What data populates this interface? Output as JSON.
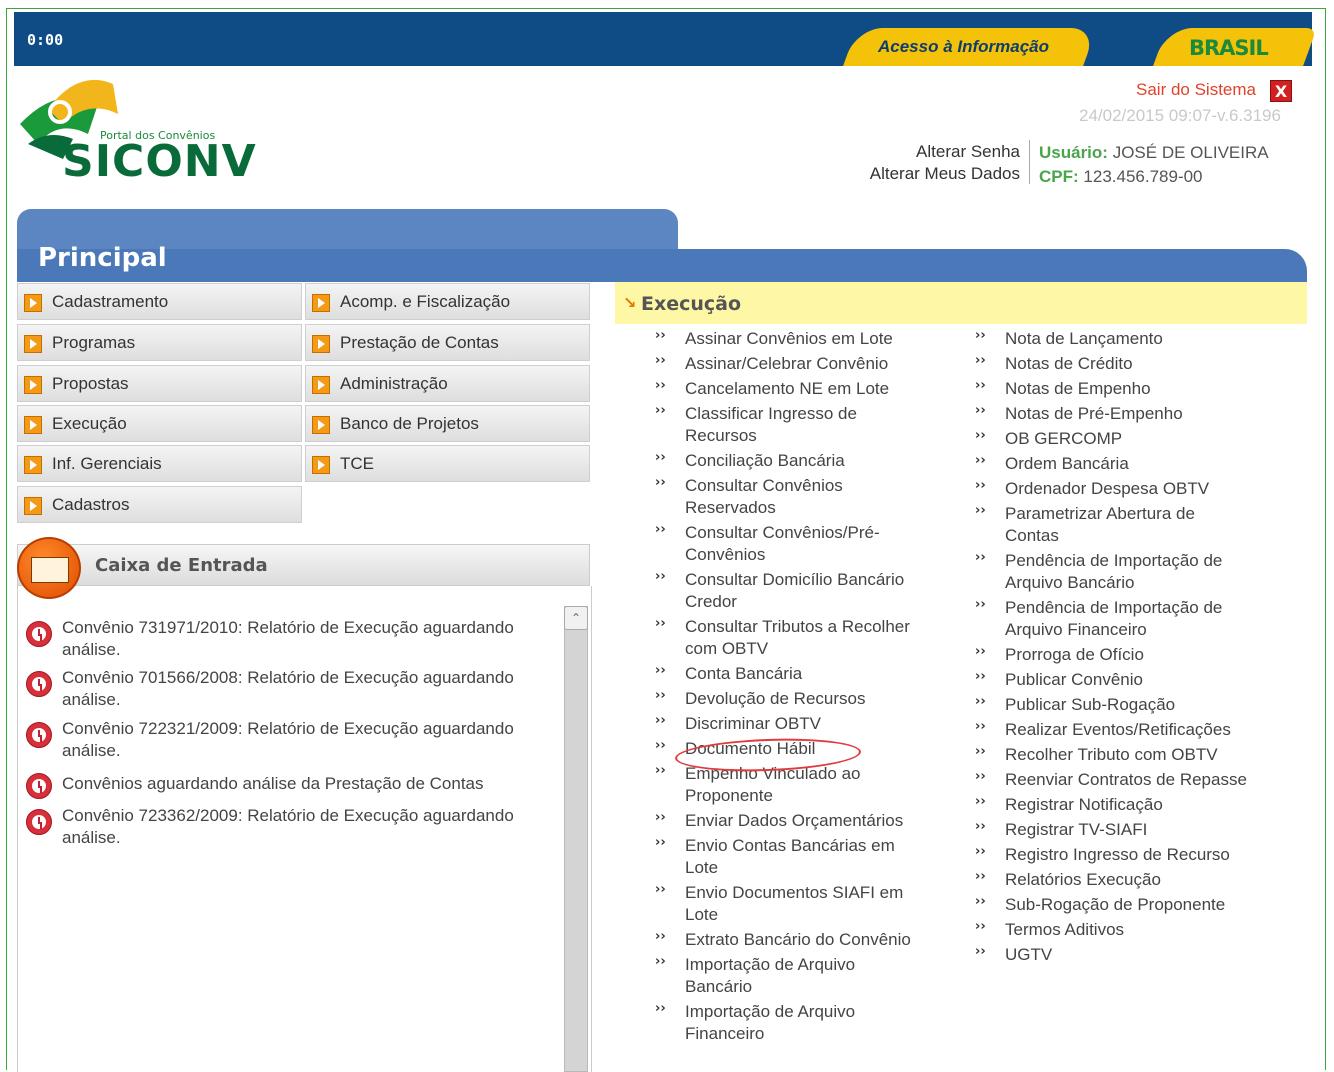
{
  "header": {
    "clock": "0:00",
    "acesso_label": "Acesso à Informação",
    "brasil_label": "BRASIL",
    "logo_sub": "Portal dos Convênios",
    "logo_main": "SICONV",
    "logout_label": "Sair do Sistema",
    "logout_icon": "X",
    "version": "24/02/2015 09:07-v.6.3196",
    "change_password": "Alterar Senha",
    "change_data": "Alterar Meus Dados",
    "user_label": "Usuário:",
    "user_name": "JOSÉ DE OLIVEIRA",
    "cpf_label": "CPF:",
    "cpf_value": "123.456.789-00"
  },
  "principal": {
    "title": "Principal"
  },
  "menu": {
    "left": [
      "Cadastramento",
      "Programas",
      "Propostas",
      "Execução",
      "Inf. Gerenciais",
      "Cadastros"
    ],
    "right": [
      "Acomp. e Fiscalização",
      "Prestação de Contas",
      "Administração",
      "Banco de Projetos",
      "TCE"
    ]
  },
  "inbox": {
    "title": "Caixa de Entrada",
    "messages": [
      "Convênio 731971/2010: Relatório de Execução aguardando análise.",
      "Convênio 701566/2008: Relatório de Execução aguardando análise.",
      "Convênio 722321/2009: Relatório de Execução aguardando análise.",
      "Convênios aguardando análise da Prestação de Contas",
      "Convênio 723362/2009: Relatório de Execução aguardando análise."
    ]
  },
  "execucao": {
    "title": "Execução",
    "col1": [
      "Assinar Convênios em Lote",
      "Assinar/Celebrar Convênio",
      "Cancelamento NE em Lote",
      "Classificar Ingresso de Recursos",
      "Conciliação Bancária",
      "Consultar Convênios Reservados",
      "Consultar Convênios/Pré-Convênios",
      "Consultar Domicílio Bancário Credor",
      "Consultar Tributos a Recolher com OBTV",
      "Conta Bancária",
      "Devolução de Recursos",
      "Discriminar OBTV",
      "Documento Hábil",
      "Empenho Vinculado ao Proponente",
      "Enviar Dados Orçamentários",
      "Envio Contas Bancárias em Lote",
      "Envio Documentos SIAFI em Lote",
      "Extrato Bancário do Convênio",
      "Importação de Arquivo Bancário",
      "Importação de Arquivo Financeiro"
    ],
    "col2": [
      "Nota de Lançamento",
      "Notas de Crédito",
      "Notas de Empenho",
      "Notas de Pré-Empenho",
      "OB GERCOMP",
      "Ordem Bancária",
      "Ordenador Despesa OBTV",
      "Parametrizar Abertura de Contas",
      "Pendência de Importação de Arquivo Bancário",
      "Pendência de Importação de Arquivo Financeiro",
      "Prorroga de Ofício",
      "Publicar Convênio",
      "Publicar Sub-Rogação",
      "Realizar Eventos/Retificações",
      "Recolher Tributo com OBTV",
      "Reenviar Contratos de Repasse",
      "Registrar Notificação",
      "Registrar TV-SIAFI",
      "Registro Ingresso de Recurso",
      "Relatórios Execução",
      "Sub-Rogação de Proponente",
      "Termos Aditivos",
      "UGTV"
    ],
    "bullet": "››",
    "arrow": "↘"
  }
}
